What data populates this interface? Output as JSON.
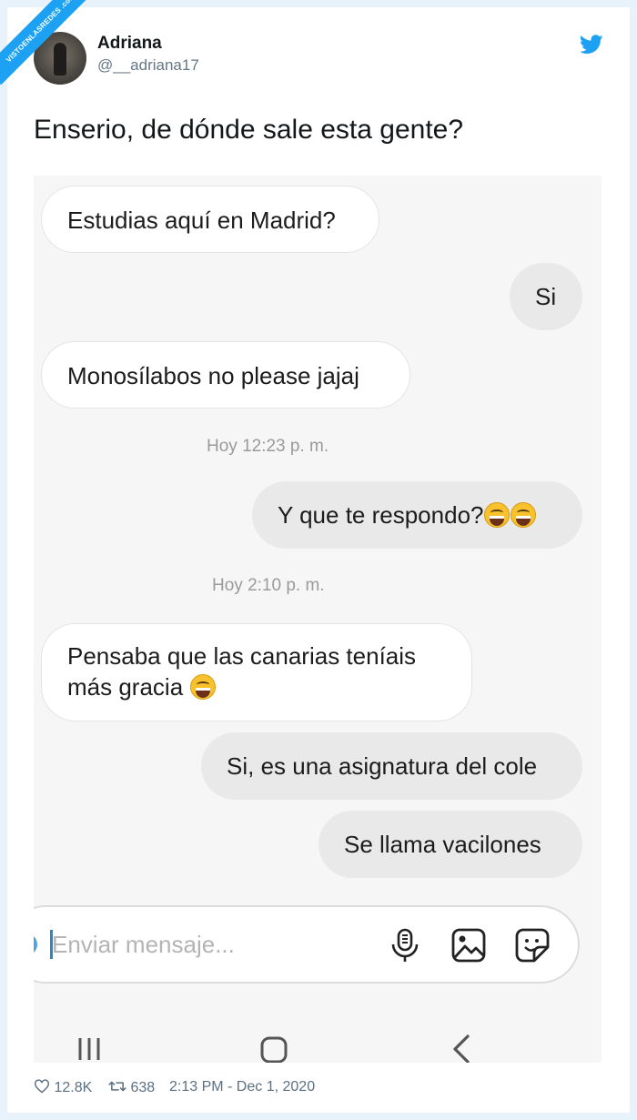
{
  "watermark": {
    "text": "VISTOENLASREDES .com"
  },
  "tweet": {
    "author_name": "Adriana",
    "author_handle": "@__adriana17",
    "text": "Enserio, de dónde sale esta gente?",
    "likes": "12.8K",
    "retweets": "638",
    "timestamp": "2:13 PM - Dec 1, 2020"
  },
  "chat": {
    "messages": [
      {
        "side": "in",
        "text": "Estudias aquí en Madrid?"
      },
      {
        "side": "out",
        "text": "Si"
      },
      {
        "side": "in",
        "text": "Monosílabos no please jajaj"
      },
      {
        "side": "out",
        "text": "Y que te respondo?"
      },
      {
        "side": "in",
        "line1": "Pensaba que las canarias teníais",
        "line2": "más gracia"
      },
      {
        "side": "out",
        "text": "Si, es una asignatura del cole"
      },
      {
        "side": "out",
        "text": "Se llama vacilones"
      }
    ],
    "timestamps": [
      "Hoy 12:23 p. m.",
      "Hoy 2:10 p. m."
    ],
    "input_placeholder": "Enviar mensaje..."
  },
  "icons": {
    "message_emoji": "grinning-squinting-face-with-sweat",
    "input_icons": [
      "microphone-icon",
      "gallery-icon",
      "sticker-icon"
    ],
    "nav_icons": [
      "recent-apps-icon",
      "home-icon",
      "back-icon"
    ]
  },
  "colors": {
    "twitter_blue": "#1da1f2",
    "page_bg": "#e8f2fa",
    "chat_bg": "#f6f6f6"
  }
}
